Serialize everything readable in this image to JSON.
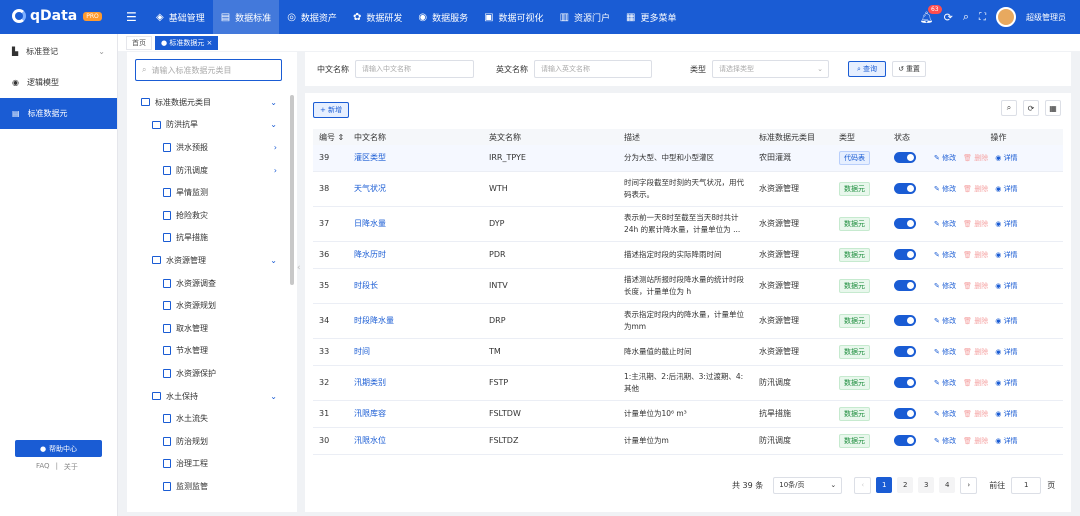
{
  "brand": {
    "name": "qData",
    "badge": "PRO"
  },
  "topnav": [
    {
      "icon": "cube-icon",
      "label": "基础管理"
    },
    {
      "icon": "book-icon",
      "label": "数据标准",
      "active": true
    },
    {
      "icon": "target-icon",
      "label": "数据资产"
    },
    {
      "icon": "gear-icon",
      "label": "数据研发"
    },
    {
      "icon": "service-icon",
      "label": "数据服务"
    },
    {
      "icon": "chart-icon",
      "label": "数据可视化"
    },
    {
      "icon": "portal-icon",
      "label": "资源门户"
    },
    {
      "icon": "grid-icon",
      "label": "更多菜单"
    }
  ],
  "header": {
    "notification_count": "63",
    "username": "超级管理员"
  },
  "sidebar": {
    "items": [
      {
        "label": "标准登记",
        "icon": "register-icon",
        "arrow": "⌄"
      },
      {
        "label": "逻辑模型",
        "icon": "model-icon",
        "arrow": ""
      },
      {
        "label": "标准数据元",
        "icon": "data-icon",
        "arrow": "",
        "active": true
      }
    ],
    "help": "帮助中心",
    "faq": "FAQ",
    "about": "关于"
  },
  "tabs": [
    {
      "label": "首页"
    },
    {
      "label": "● 标准数据元 ×",
      "active": true
    }
  ],
  "tree": {
    "placeholder": "请输入标准数据元类目",
    "nodes": [
      {
        "label": "标准数据元类目",
        "level": 0,
        "toggle": "⌄"
      },
      {
        "label": "防洪抗旱",
        "level": 1,
        "toggle": "⌄"
      },
      {
        "label": "洪水预报",
        "level": 2,
        "toggle": "›"
      },
      {
        "label": "防汛调度",
        "level": 2,
        "toggle": "›"
      },
      {
        "label": "旱情监测",
        "level": 2,
        "toggle": ""
      },
      {
        "label": "抢险救灾",
        "level": 2,
        "toggle": ""
      },
      {
        "label": "抗旱措施",
        "level": 2,
        "toggle": ""
      },
      {
        "label": "水资源管理",
        "level": 1,
        "toggle": "⌄"
      },
      {
        "label": "水资源调查",
        "level": 2,
        "toggle": ""
      },
      {
        "label": "水资源规划",
        "level": 2,
        "toggle": ""
      },
      {
        "label": "取水管理",
        "level": 2,
        "toggle": ""
      },
      {
        "label": "节水管理",
        "level": 2,
        "toggle": ""
      },
      {
        "label": "水资源保护",
        "level": 2,
        "toggle": ""
      },
      {
        "label": "水土保持",
        "level": 1,
        "toggle": "⌄"
      },
      {
        "label": "水土流失",
        "level": 2,
        "toggle": ""
      },
      {
        "label": "防治规划",
        "level": 2,
        "toggle": ""
      },
      {
        "label": "治理工程",
        "level": 2,
        "toggle": ""
      },
      {
        "label": "监测监管",
        "level": 2,
        "toggle": ""
      }
    ]
  },
  "filter": {
    "cn_label": "中文名称",
    "cn_placeholder": "请输入中文名称",
    "en_label": "英文名称",
    "en_placeholder": "请输入英文名称",
    "type_label": "类型",
    "type_placeholder": "请选择类型",
    "query": "查询",
    "reset": "重置"
  },
  "toolbar": {
    "add": "+ 新增"
  },
  "table": {
    "headers": [
      "编号 ⇕",
      "中文名称",
      "英文名称",
      "描述",
      "标准数据元类目",
      "类型",
      "状态",
      "操作"
    ],
    "rows": [
      {
        "id": "39",
        "cn": "灌区类型",
        "en": "IRR_TPYE",
        "desc": "分为大型、中型和小型灌区",
        "cat": "农田灌溉",
        "type": "代码表",
        "type_color": "blue"
      },
      {
        "id": "38",
        "cn": "天气状况",
        "en": "WTH",
        "desc": "时间字段截至时刻的天气状况，用代码表示。",
        "cat": "水资源管理",
        "type": "数据元",
        "type_color": "green"
      },
      {
        "id": "37",
        "cn": "日降水量",
        "en": "DYP",
        "desc": "表示前一天8时至截至当天8时共计24h 的累计降水量，计量单位为 ...",
        "cat": "水资源管理",
        "type": "数据元",
        "type_color": "green"
      },
      {
        "id": "36",
        "cn": "降水历时",
        "en": "PDR",
        "desc": "描述指定时段的实际降雨时间",
        "cat": "水资源管理",
        "type": "数据元",
        "type_color": "green"
      },
      {
        "id": "35",
        "cn": "时段长",
        "en": "INTV",
        "desc": "描述测站所报时段降水量的统计时段长度，计量单位为 h",
        "cat": "水资源管理",
        "type": "数据元",
        "type_color": "green"
      },
      {
        "id": "34",
        "cn": "时段降水量",
        "en": "DRP",
        "desc": "表示指定时段内的降水量，计量单位为mm",
        "cat": "水资源管理",
        "type": "数据元",
        "type_color": "green"
      },
      {
        "id": "33",
        "cn": "时间",
        "en": "TM",
        "desc": "降水量值的截止时间",
        "cat": "水资源管理",
        "type": "数据元",
        "type_color": "green"
      },
      {
        "id": "32",
        "cn": "汛期类别",
        "en": "FSTP",
        "desc": "1:主汛期、2:后汛期、3:过渡期、4:其他",
        "cat": "防汛调度",
        "type": "数据元",
        "type_color": "green"
      },
      {
        "id": "31",
        "cn": "汛限库容",
        "en": "FSLTDW",
        "desc": "计量单位为10⁶ m³",
        "cat": "抗旱措施",
        "type": "数据元",
        "type_color": "green"
      },
      {
        "id": "30",
        "cn": "汛限水位",
        "en": "FSLTDZ",
        "desc": "计量单位为m",
        "cat": "防汛调度",
        "type": "数据元",
        "type_color": "green"
      }
    ],
    "ops": {
      "edit": "修改",
      "delete": "删除",
      "detail": "详情"
    }
  },
  "pagination": {
    "total": "共 39 条",
    "page_size": "10条/页",
    "pages": [
      "1",
      "2",
      "3",
      "4"
    ],
    "current": "1",
    "goto_label": "前往",
    "goto_value": "1",
    "page_suffix": "页"
  }
}
